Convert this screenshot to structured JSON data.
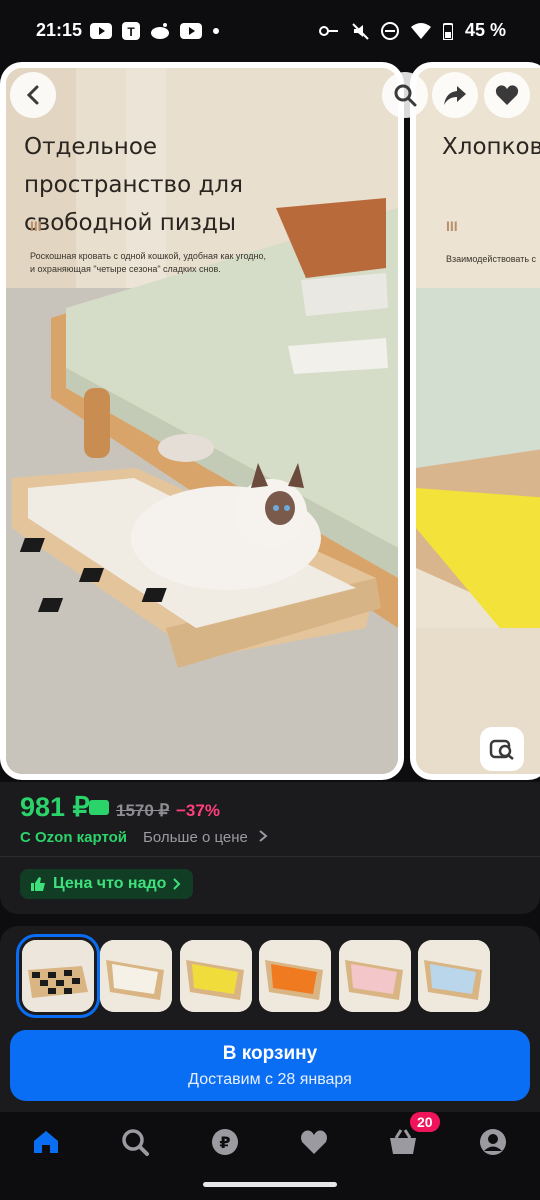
{
  "status": {
    "time": "21:15",
    "battery": "45 %"
  },
  "gallery": {
    "card1": {
      "title": "Отдельное пространство для свободной пизды",
      "mark": "III",
      "subtitle": "Роскошная кровать с одной кошкой, удобная как угодно, и охраняющая \"четыре сезона\" сладких снов."
    },
    "card2": {
      "title": "Хлопковые и удобные",
      "mark": "III",
      "subtitle": "Взаимодействовать с"
    },
    "buttons": [
      "back-icon",
      "search-icon",
      "share-icon",
      "heart-icon",
      "visual-search-icon"
    ]
  },
  "price": {
    "current": "981 ₽",
    "old": "1570 ₽",
    "discount": "−37%",
    "ozon_card": "С Ozon картой",
    "more": "Больше о цене",
    "badge": "Цена что надо"
  },
  "thumbnails": [
    {
      "variant": "checkered",
      "selected": true
    },
    {
      "variant": "beige"
    },
    {
      "variant": "yellow"
    },
    {
      "variant": "orange"
    },
    {
      "variant": "pink"
    },
    {
      "variant": "blue"
    }
  ],
  "cart": {
    "label": "В корзину",
    "delivery": "Доставим с 28 января"
  },
  "nav": {
    "items": [
      "home-icon",
      "search-icon",
      "ruble-icon",
      "heart-icon",
      "basket-icon",
      "profile-icon"
    ],
    "basket_count": "20"
  },
  "colors": {
    "accent": "#0a6ef5",
    "green": "#2bd46a",
    "discount": "#ff3f7a",
    "badge": "#f0145a"
  }
}
